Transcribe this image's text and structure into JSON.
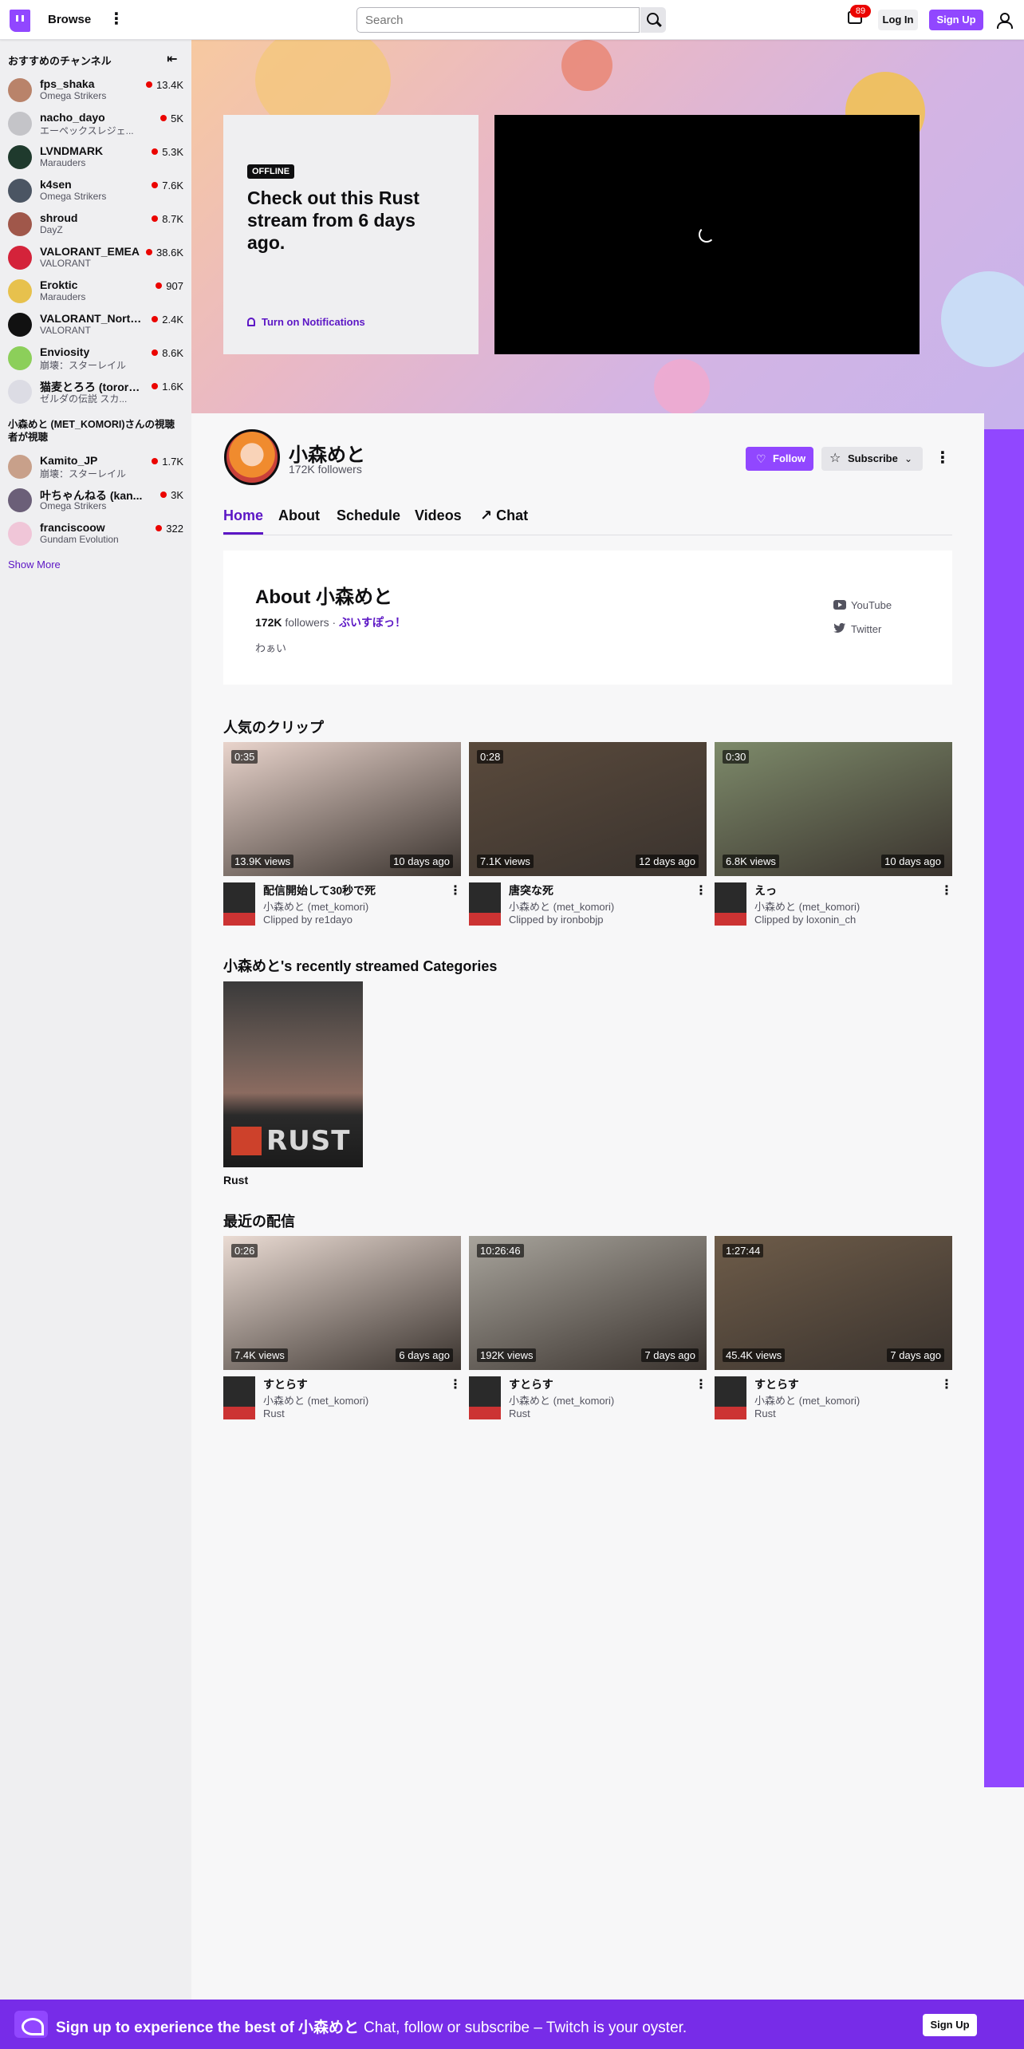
{
  "nav": {
    "browse": "Browse",
    "search_placeholder": "Search",
    "inbox_count": "89",
    "login": "Log In",
    "signup": "Sign Up"
  },
  "sidebar": {
    "recommended_header": "おすすめのチャンネル",
    "channels": [
      {
        "name": "fps_shaka",
        "game": "Omega Strikers",
        "viewers": "13.4K",
        "avatar_color": "#b9836a"
      },
      {
        "name": "nacho_dayo",
        "game": "エーペックスレジェ...",
        "viewers": "5K",
        "avatar_color": "#c4c4c8"
      },
      {
        "name": "LVNDMARK",
        "game": "Marauders",
        "viewers": "5.3K",
        "avatar_color": "#1f3a2d"
      },
      {
        "name": "k4sen",
        "game": "Omega Strikers",
        "viewers": "7.6K",
        "avatar_color": "#4b5563"
      },
      {
        "name": "shroud",
        "game": "DayZ",
        "viewers": "8.7K",
        "avatar_color": "#a0574a"
      },
      {
        "name": "VALORANT_EMEA",
        "game": "VALORANT",
        "viewers": "38.6K",
        "avatar_color": "#d4233a"
      },
      {
        "name": "Eroktic",
        "game": "Marauders",
        "viewers": "907",
        "avatar_color": "#e7c14d"
      },
      {
        "name": "VALORANT_North...",
        "game": "VALORANT",
        "viewers": "2.4K",
        "avatar_color": "#111111"
      },
      {
        "name": "Enviosity",
        "game": "崩壊：スターレイル",
        "viewers": "8.6K",
        "avatar_color": "#8ccf5a"
      },
      {
        "name": "猫麦とろろ (tororo...",
        "game": "ゼルダの伝説 スカ...",
        "viewers": "1.6K",
        "avatar_color": "#dcdce4"
      }
    ],
    "viewers_also_header": "小森めと (MET_KOMORI)さんの視聴者が視聴",
    "also_channels": [
      {
        "name": "Kamito_JP",
        "game": "崩壊：スターレイル",
        "viewers": "1.7K",
        "avatar_color": "#c8a08a"
      },
      {
        "name": "叶ちゃんねる (kan...",
        "game": "Omega Strikers",
        "viewers": "3K",
        "avatar_color": "#6b5f78"
      },
      {
        "name": "franciscoow",
        "game": "Gundam Evolution",
        "viewers": "322",
        "avatar_color": "#f0c6d8"
      }
    ],
    "show_more": "Show More"
  },
  "offline": {
    "badge": "OFFLINE",
    "title": "Check out this Rust stream from 6 days ago.",
    "notifications": "Turn on Notifications"
  },
  "profile": {
    "name": "小森めと",
    "followers": "172K followers",
    "follow": "Follow",
    "subscribe": "Subscribe"
  },
  "tabs": [
    "Home",
    "About",
    "Schedule",
    "Videos",
    "Chat"
  ],
  "about": {
    "title": "About 小森めと",
    "followers_count": "172K",
    "followers_word": "followers",
    "separator": "·",
    "team": "ぶいすぽっ！",
    "bio": "わぁい",
    "youtube": "YouTube",
    "twitter": "Twitter"
  },
  "clips": {
    "title": "人気のクリップ",
    "items": [
      {
        "duration": "0:35",
        "views": "13.9K views",
        "ago": "10 days ago",
        "title": "配信開始して30秒で死",
        "channel": "小森めと (met_komori)",
        "clipped_by": "Clipped by re1dayo",
        "thumb": "#e9d4cc"
      },
      {
        "duration": "0:28",
        "views": "7.1K views",
        "ago": "12 days ago",
        "title": "唐突な死",
        "channel": "小森めと (met_komori)",
        "clipped_by": "Clipped by ironbobjp",
        "thumb": "#5a4a3c"
      },
      {
        "duration": "0:30",
        "views": "6.8K views",
        "ago": "10 days ago",
        "title": "えっ",
        "channel": "小森めと (met_komori)",
        "clipped_by": "Clipped by loxonin_ch",
        "thumb": "#7d8a6a"
      }
    ]
  },
  "categories": {
    "title": "小森めと's recently streamed Categories",
    "items": [
      {
        "name": "Rust",
        "logo_text": "RUST"
      }
    ]
  },
  "recent": {
    "title": "最近の配信",
    "items": [
      {
        "duration": "0:26",
        "views": "7.4K views",
        "ago": "6 days ago",
        "title": "すとらす",
        "channel": "小森めと (met_komori)",
        "game": "Rust",
        "thumb": "#eadbd3"
      },
      {
        "duration": "10:26:46",
        "views": "192K views",
        "ago": "7 days ago",
        "title": "すとらす",
        "channel": "小森めと (met_komori)",
        "game": "Rust",
        "thumb": "#a8a49c"
      },
      {
        "duration": "1:27:44",
        "views": "45.4K views",
        "ago": "7 days ago",
        "title": "すとらす",
        "channel": "小森めと (met_komori)",
        "game": "Rust",
        "thumb": "#6e5c49"
      }
    ]
  },
  "bottom_banner": {
    "bold": "Sign up to experience the best of 小森めと",
    "rest": "Chat, follow or subscribe – Twitch is your oyster.",
    "signup": "Sign Up"
  },
  "colors": {
    "brand": "#9147ff",
    "link": "#5c16c5",
    "live": "#eb0400"
  }
}
